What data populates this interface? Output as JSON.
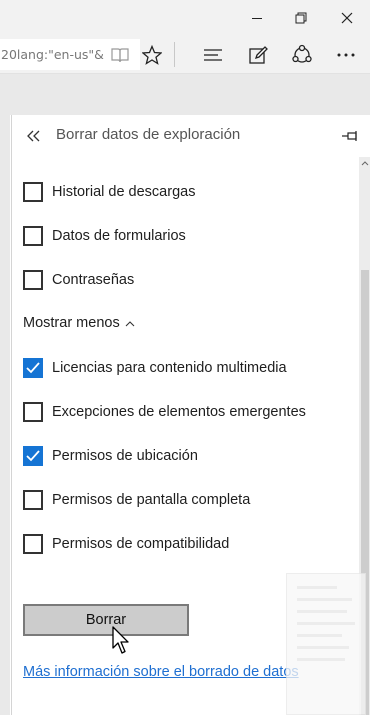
{
  "browser": {
    "address_text": "20lang:\"en-us\"&",
    "icons": [
      "minimize-icon",
      "restore-icon",
      "close-icon",
      "reading-view-icon",
      "favorite-star-icon",
      "hub-icon",
      "web-note-icon",
      "share-icon",
      "more-icon"
    ]
  },
  "panel": {
    "title": "Borrar datos de exploración",
    "items_top": [
      {
        "label": "Historial de descargas",
        "checked": false
      },
      {
        "label": "Datos de formularios",
        "checked": false
      },
      {
        "label": "Contraseñas",
        "checked": false
      }
    ],
    "show_less_label": "Mostrar menos",
    "items_bottom": [
      {
        "label": "Licencias para contenido multimedia",
        "checked": true
      },
      {
        "label": "Excepciones de elementos emergentes",
        "checked": false
      },
      {
        "label": "Permisos de ubicación",
        "checked": true
      },
      {
        "label": "Permisos de pantalla completa",
        "checked": false
      },
      {
        "label": "Permisos de compatibilidad",
        "checked": false
      }
    ],
    "clear_button_label": "Borrar",
    "more_info_link": "Más información sobre el borrado de datos"
  },
  "colors": {
    "accent": "#1574d4",
    "link": "#1f6fd1"
  }
}
